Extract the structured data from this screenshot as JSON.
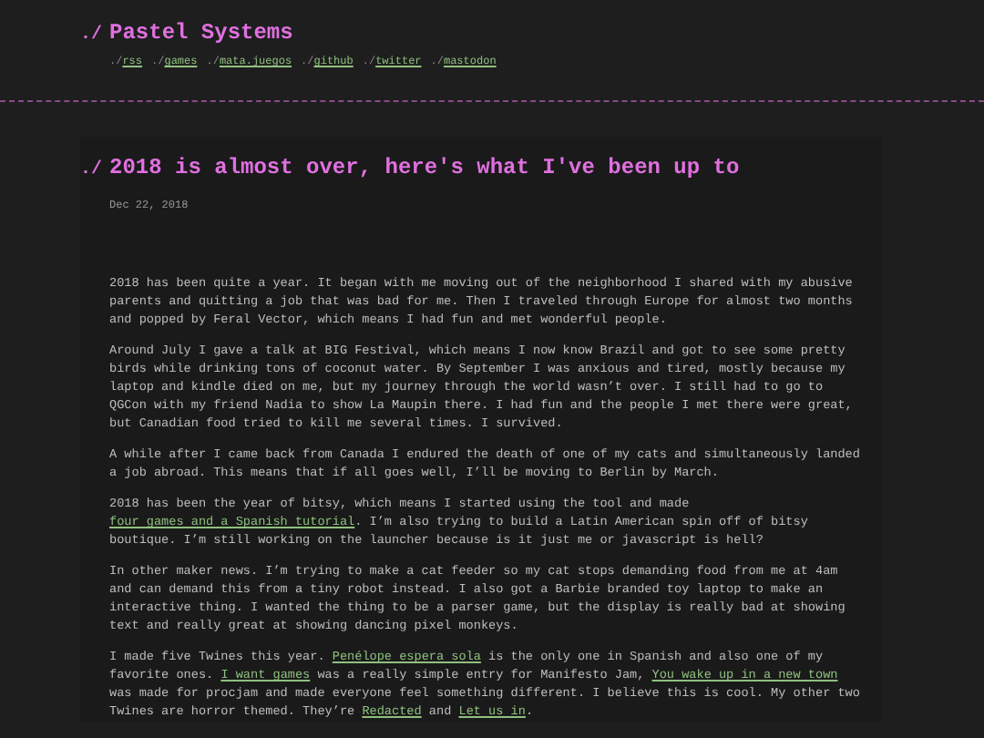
{
  "site": {
    "prefix": "./",
    "title": "Pastel Systems",
    "links": [
      {
        "prefix": "./",
        "label": "rss"
      },
      {
        "prefix": "./",
        "label": "games"
      },
      {
        "prefix": "./",
        "label": "mata.juegos"
      },
      {
        "prefix": "./",
        "label": "github"
      },
      {
        "prefix": "./",
        "label": "twitter"
      },
      {
        "prefix": "./",
        "label": "mastodon"
      }
    ]
  },
  "post": {
    "prefix": "./",
    "title": "2018 is almost over, here's what I've been up to",
    "date": "Dec 22, 2018",
    "paragraphs": [
      [
        {
          "kind": "text",
          "text": "2018 has been quite a year. It began with me moving out of the neighborhood I shared with my abusive parents and quitting a job that was bad for me. Then I traveled through Europe for almost two months and popped by Feral Vector, which means I had fun and met wonderful people."
        }
      ],
      [
        {
          "kind": "text",
          "text": "Around July I gave a talk at BIG Festival, which means I now know Brazil and got to see some pretty birds while drinking tons of coconut water. By September I was anxious and tired, mostly because my laptop and kindle died on me, but my journey through the world wasn’t over. I still had to go to QGCon with my friend Nadia to show La Maupin there. I had fun and the people I met there were great, but Canadian food tried to kill me several times. I survived."
        }
      ],
      [
        {
          "kind": "text",
          "text": "A while after I came back from Canada I endured the death of one of my cats and simultaneously landed a job abroad. This means that if all goes well, I’ll be moving to Berlin by March."
        }
      ],
      [
        {
          "kind": "text",
          "text": "2018 has been the year of bitsy, which means I started using the tool and made "
        },
        {
          "kind": "link",
          "text": "four games and a Spanish tutorial"
        },
        {
          "kind": "text",
          "text": ". I’m also trying to build a Latin American spin off of bitsy boutique. I’m still working on the launcher because is it just me or javascript is hell?"
        }
      ],
      [
        {
          "kind": "text",
          "text": "In other maker news. I’m trying to make a cat feeder so my cat stops demanding food from me at 4am and can demand this from a tiny robot instead. I also got a Barbie branded toy laptop to make an interactive thing. I wanted the thing to be a parser game, but the display is really bad at showing text and really great at showing dancing pixel monkeys."
        }
      ],
      [
        {
          "kind": "text",
          "text": "I made five Twines this year. "
        },
        {
          "kind": "link",
          "text": "Penélope espera sola"
        },
        {
          "kind": "text",
          "text": " is the only one in Spanish and also one of my favorite ones. "
        },
        {
          "kind": "link",
          "text": "I want games"
        },
        {
          "kind": "text",
          "text": " was a really simple entry for Manifesto Jam, "
        },
        {
          "kind": "link",
          "text": "You wake up in a new town"
        },
        {
          "kind": "text",
          "text": " was made for procjam and made everyone feel something different. I believe this is cool. My other two Twines are horror themed. They’re "
        },
        {
          "kind": "link",
          "text": "Redacted"
        },
        {
          "kind": "text",
          "text": " and "
        },
        {
          "kind": "link",
          "text": "Let us in"
        },
        {
          "kind": "text",
          "text": "."
        }
      ]
    ]
  }
}
